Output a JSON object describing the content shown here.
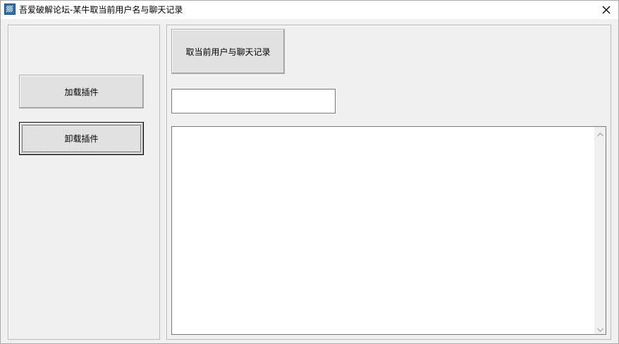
{
  "window": {
    "title": "吾爱破解论坛-某牛取当前用户名与聊天记录",
    "icon": "app-logo-icon",
    "close_icon": "close-icon"
  },
  "left_panel": {
    "load_button_label": "加载插件",
    "unload_button_label": "卸载插件"
  },
  "right_panel": {
    "get_button_label": "取当前用户与聊天记录",
    "username_field": {
      "value": "",
      "placeholder": ""
    },
    "chat_log": {
      "value": ""
    }
  },
  "colors": {
    "window_bg": "#f0f0f0",
    "titlebar_bg": "#ffffff",
    "button_bg": "#e1e1e1",
    "border": "#7a7a7a"
  }
}
